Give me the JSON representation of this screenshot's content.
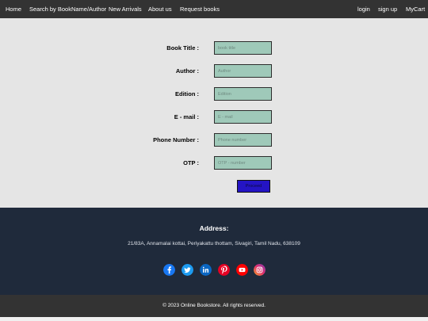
{
  "nav": {
    "left": [
      "Home",
      "Search by BookName/Author",
      "New Arrivals",
      "About us",
      "Request books"
    ],
    "right": [
      "login",
      "sign up",
      "MyCart"
    ]
  },
  "form": {
    "fields": [
      {
        "label": "Book Title :",
        "placeholder": "book title"
      },
      {
        "label": "Author :",
        "placeholder": "Author"
      },
      {
        "label": "Edition :",
        "placeholder": "Edition"
      },
      {
        "label": "E - mail :",
        "placeholder": "E - mail"
      },
      {
        "label": "Phone Number :",
        "placeholder": "Phone number"
      },
      {
        "label": "OTP :",
        "placeholder": "OTP - number"
      }
    ],
    "proceed_label": "Proceed"
  },
  "footer": {
    "heading": "Address:",
    "address": "21/83A, Annamalai kottai, Periyakattu thottam, Sivagiri, Tamil Nadu, 638109",
    "social": [
      {
        "icon": "facebook-icon",
        "color": "#1877f2"
      },
      {
        "icon": "twitter-icon",
        "color": "#1d9bf0"
      },
      {
        "icon": "linkedin-icon",
        "color": "#0a66c2"
      },
      {
        "icon": "pinterest-icon",
        "color": "#e60023"
      },
      {
        "icon": "youtube-icon",
        "color": "#ff0000"
      },
      {
        "icon": "instagram-icon",
        "color": "#c13584"
      }
    ]
  },
  "copyright": "© 2023 Online Bookstore. All rights reserved.",
  "colors": {
    "navbar": "#333333",
    "form_background": "#e5e5e5",
    "input_fill": "#9fc9b9",
    "proceed_button": "#2414c4",
    "footer": "#1f2a3b"
  }
}
